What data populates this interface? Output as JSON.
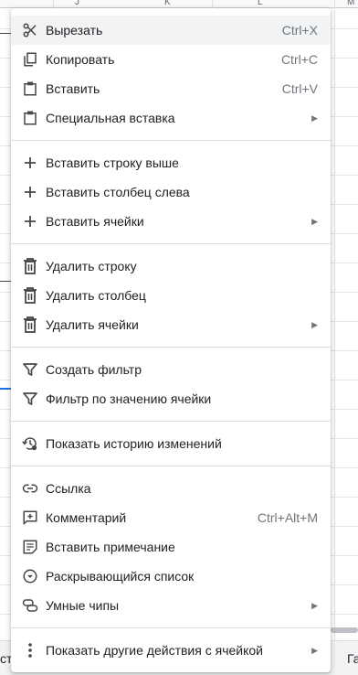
{
  "sheet": {
    "columns": [
      "J",
      "K",
      "L",
      "M"
    ],
    "bottom_left_text": "ст",
    "bottom_right_text": "Га"
  },
  "menu": {
    "items": [
      {
        "label": "Вырезать",
        "shortcut": "Ctrl+X",
        "icon": "scissors-icon"
      },
      {
        "label": "Копировать",
        "shortcut": "Ctrl+C",
        "icon": "copy-icon"
      },
      {
        "label": "Вставить",
        "shortcut": "Ctrl+V",
        "icon": "clipboard-icon"
      },
      {
        "label": "Специальная вставка",
        "submenu": true,
        "icon": "clipboard-icon"
      },
      {
        "label": "Вставить строку выше",
        "icon": "plus-icon"
      },
      {
        "label": "Вставить столбец слева",
        "icon": "plus-icon"
      },
      {
        "label": "Вставить ячейки",
        "submenu": true,
        "icon": "plus-icon"
      },
      {
        "label": "Удалить строку",
        "icon": "trash-icon"
      },
      {
        "label": "Удалить столбец",
        "icon": "trash-icon"
      },
      {
        "label": "Удалить ячейки",
        "submenu": true,
        "icon": "trash-icon"
      },
      {
        "label": "Создать фильтр",
        "icon": "filter-icon"
      },
      {
        "label": "Фильтр по значению ячейки",
        "icon": "filter-icon"
      },
      {
        "label": "Показать историю изменений",
        "icon": "history-icon"
      },
      {
        "label": "Ссылка",
        "icon": "link-icon"
      },
      {
        "label": "Комментарий",
        "shortcut": "Ctrl+Alt+M",
        "icon": "add-comment-icon"
      },
      {
        "label": "Вставить примечание",
        "icon": "note-icon"
      },
      {
        "label": "Раскрывающийся список",
        "icon": "dropdown-icon"
      },
      {
        "label": "Умные чипы",
        "submenu": true,
        "icon": "smart-chip-icon"
      },
      {
        "label": "Показать другие действия с ячейкой",
        "submenu": true,
        "icon": "more-vert-icon"
      }
    ]
  }
}
